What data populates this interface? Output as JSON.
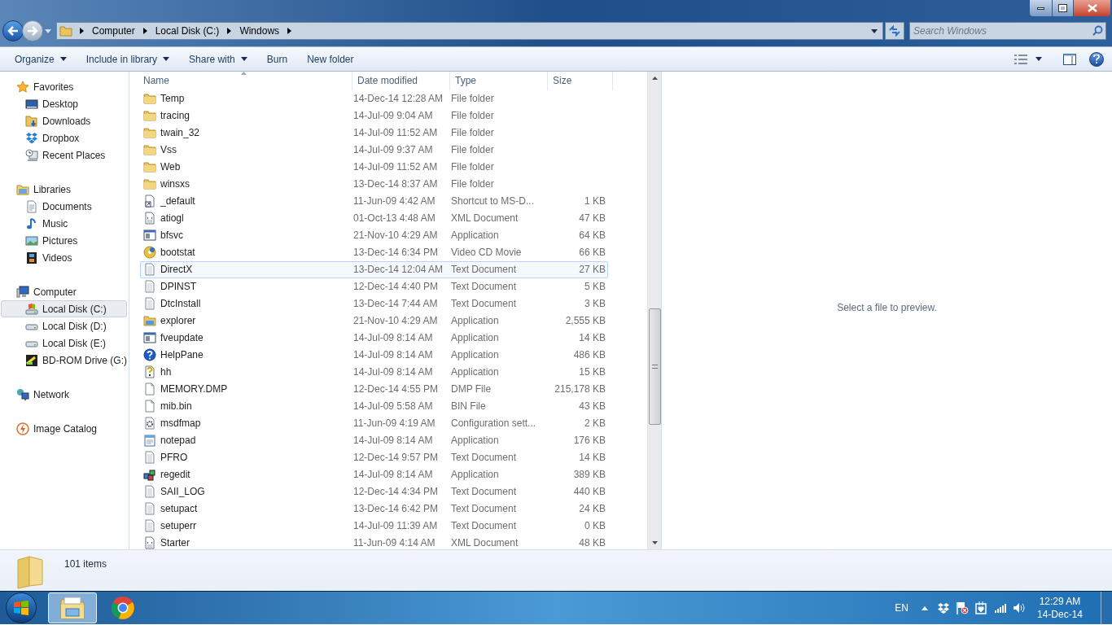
{
  "address": {
    "breadcrumb": [
      "Computer",
      "Local Disk (C:)",
      "Windows"
    ]
  },
  "search": {
    "placeholder": "Search Windows"
  },
  "toolbar": [
    {
      "label": "Organize",
      "dropdown": true
    },
    {
      "label": "Include in library",
      "dropdown": true
    },
    {
      "label": "Share with",
      "dropdown": true
    },
    {
      "label": "Burn",
      "dropdown": false
    },
    {
      "label": "New folder",
      "dropdown": false
    }
  ],
  "sidebar": [
    {
      "label": "Favorites",
      "kind": "star",
      "selected": false,
      "children": [
        {
          "label": "Desktop",
          "kind": "desktop",
          "selected": false
        },
        {
          "label": "Downloads",
          "kind": "downloads",
          "selected": false
        },
        {
          "label": "Dropbox",
          "kind": "dropbox",
          "selected": false
        },
        {
          "label": "Recent Places",
          "kind": "recent",
          "selected": false
        }
      ]
    },
    {
      "label": "Libraries",
      "kind": "library",
      "selected": false,
      "children": [
        {
          "label": "Documents",
          "kind": "document",
          "selected": false
        },
        {
          "label": "Music",
          "kind": "music",
          "selected": false
        },
        {
          "label": "Pictures",
          "kind": "pictures",
          "selected": false
        },
        {
          "label": "Videos",
          "kind": "videos",
          "selected": false
        }
      ]
    },
    {
      "label": "Computer",
      "kind": "computer",
      "selected": false,
      "children": [
        {
          "label": "Local Disk (C:)",
          "kind": "systemdisk",
          "selected": true
        },
        {
          "label": "Local Disk (D:)",
          "kind": "disk",
          "selected": false
        },
        {
          "label": "Local Disk (E:)",
          "kind": "disk",
          "selected": false
        },
        {
          "label": "BD-ROM Drive (G:)",
          "kind": "optical",
          "selected": false
        }
      ]
    },
    {
      "label": "Network",
      "kind": "network",
      "selected": false
    },
    {
      "label": "Image Catalog",
      "kind": "catalog",
      "selected": false
    }
  ],
  "table": {
    "columns": [
      {
        "label": "Name",
        "sorted": true
      },
      {
        "label": "Date modified",
        "sorted": false
      },
      {
        "label": "Type",
        "sorted": false
      },
      {
        "label": "Size",
        "sorted": false
      }
    ],
    "rows": [
      {
        "name": "Temp",
        "date": "14-Dec-14 12:28 AM",
        "type": "File folder",
        "kind": "folder",
        "selected": false
      },
      {
        "name": "tracing",
        "date": "14-Jul-09 9:04 AM",
        "type": "File folder",
        "kind": "folder",
        "selected": false
      },
      {
        "name": "twain_32",
        "date": "14-Jul-09 11:52 AM",
        "type": "File folder",
        "kind": "folder",
        "selected": false
      },
      {
        "name": "Vss",
        "date": "14-Jul-09 9:37 AM",
        "type": "File folder",
        "kind": "folder",
        "selected": false
      },
      {
        "name": "Web",
        "date": "14-Jul-09 11:52 AM",
        "type": "File folder",
        "kind": "folder",
        "selected": false
      },
      {
        "name": "winsxs",
        "date": "13-Dec-14 8:37 AM",
        "type": "File folder",
        "kind": "folder",
        "selected": false
      },
      {
        "name": "_default",
        "date": "11-Jun-09 4:42 AM",
        "type": "Shortcut to MS-D...",
        "size": "1 KB",
        "kind": "shortcut",
        "selected": false
      },
      {
        "name": "atiogl",
        "date": "01-Oct-13 4:48 AM",
        "type": "XML Document",
        "size": "47 KB",
        "kind": "xml",
        "selected": false
      },
      {
        "name": "bfsvc",
        "date": "21-Nov-10 4:29 AM",
        "type": "Application",
        "size": "64 KB",
        "kind": "application",
        "selected": false
      },
      {
        "name": "bootstat",
        "date": "13-Dec-14 6:34 PM",
        "type": "Video CD Movie",
        "size": "66 KB",
        "kind": "disc",
        "selected": false
      },
      {
        "name": "DirectX",
        "date": "13-Dec-14 12:04 AM",
        "type": "Text Document",
        "size": "27 KB",
        "kind": "text",
        "selected": true
      },
      {
        "name": "DPINST",
        "date": "12-Dec-14 4:40 PM",
        "type": "Text Document",
        "size": "5 KB",
        "kind": "text",
        "selected": false
      },
      {
        "name": "DtcInstall",
        "date": "13-Dec-14 7:44 AM",
        "type": "Text Document",
        "size": "3 KB",
        "kind": "text",
        "selected": false
      },
      {
        "name": "explorer",
        "date": "21-Nov-10 4:29 AM",
        "type": "Application",
        "size": "2,555 KB",
        "kind": "explorer",
        "selected": false
      },
      {
        "name": "fveupdate",
        "date": "14-Jul-09 8:14 AM",
        "type": "Application",
        "size": "14 KB",
        "kind": "application",
        "selected": false
      },
      {
        "name": "HelpPane",
        "date": "14-Jul-09 8:14 AM",
        "type": "Application",
        "size": "486 KB",
        "kind": "help",
        "selected": false
      },
      {
        "name": "hh",
        "date": "14-Jul-09 8:14 AM",
        "type": "Application",
        "size": "15 KB",
        "kind": "helpfile",
        "selected": false
      },
      {
        "name": "MEMORY.DMP",
        "date": "12-Dec-14 4:55 PM",
        "type": "DMP File",
        "size": "215,178 KB",
        "kind": "file",
        "selected": false
      },
      {
        "name": "mib.bin",
        "date": "14-Jul-09 5:58 AM",
        "type": "BIN File",
        "size": "43 KB",
        "kind": "file",
        "selected": false
      },
      {
        "name": "msdfmap",
        "date": "11-Jun-09 4:19 AM",
        "type": "Configuration sett...",
        "size": "2 KB",
        "kind": "config",
        "selected": false
      },
      {
        "name": "notepad",
        "date": "14-Jul-09 8:14 AM",
        "type": "Application",
        "size": "176 KB",
        "kind": "notepad",
        "selected": false
      },
      {
        "name": "PFRO",
        "date": "12-Dec-14 9:57 PM",
        "type": "Text Document",
        "size": "14 KB",
        "kind": "text",
        "selected": false
      },
      {
        "name": "regedit",
        "date": "14-Jul-09 8:14 AM",
        "type": "Application",
        "size": "389 KB",
        "kind": "registry",
        "selected": false
      },
      {
        "name": "SAII_LOG",
        "date": "12-Dec-14 4:34 PM",
        "type": "Text Document",
        "size": "440 KB",
        "kind": "text",
        "selected": false
      },
      {
        "name": "setupact",
        "date": "13-Dec-14 6:42 PM",
        "type": "Text Document",
        "size": "24 KB",
        "kind": "text",
        "selected": false
      },
      {
        "name": "setuperr",
        "date": "14-Jul-09 11:39 AM",
        "type": "Text Document",
        "size": "0 KB",
        "kind": "text",
        "selected": false
      },
      {
        "name": "Starter",
        "date": "11-Jun-09 4:14 AM",
        "type": "XML Document",
        "size": "48 KB",
        "kind": "xml",
        "selected": false
      }
    ]
  },
  "preview": {
    "message": "Select a file to preview."
  },
  "details": {
    "count": "101 items"
  },
  "taskbar": {
    "apps": [
      {
        "kind": "explorer",
        "selected": true
      },
      {
        "kind": "browser",
        "selected": false
      }
    ],
    "language": "EN",
    "time": "12:29 AM",
    "date": "14-Dec-14"
  }
}
